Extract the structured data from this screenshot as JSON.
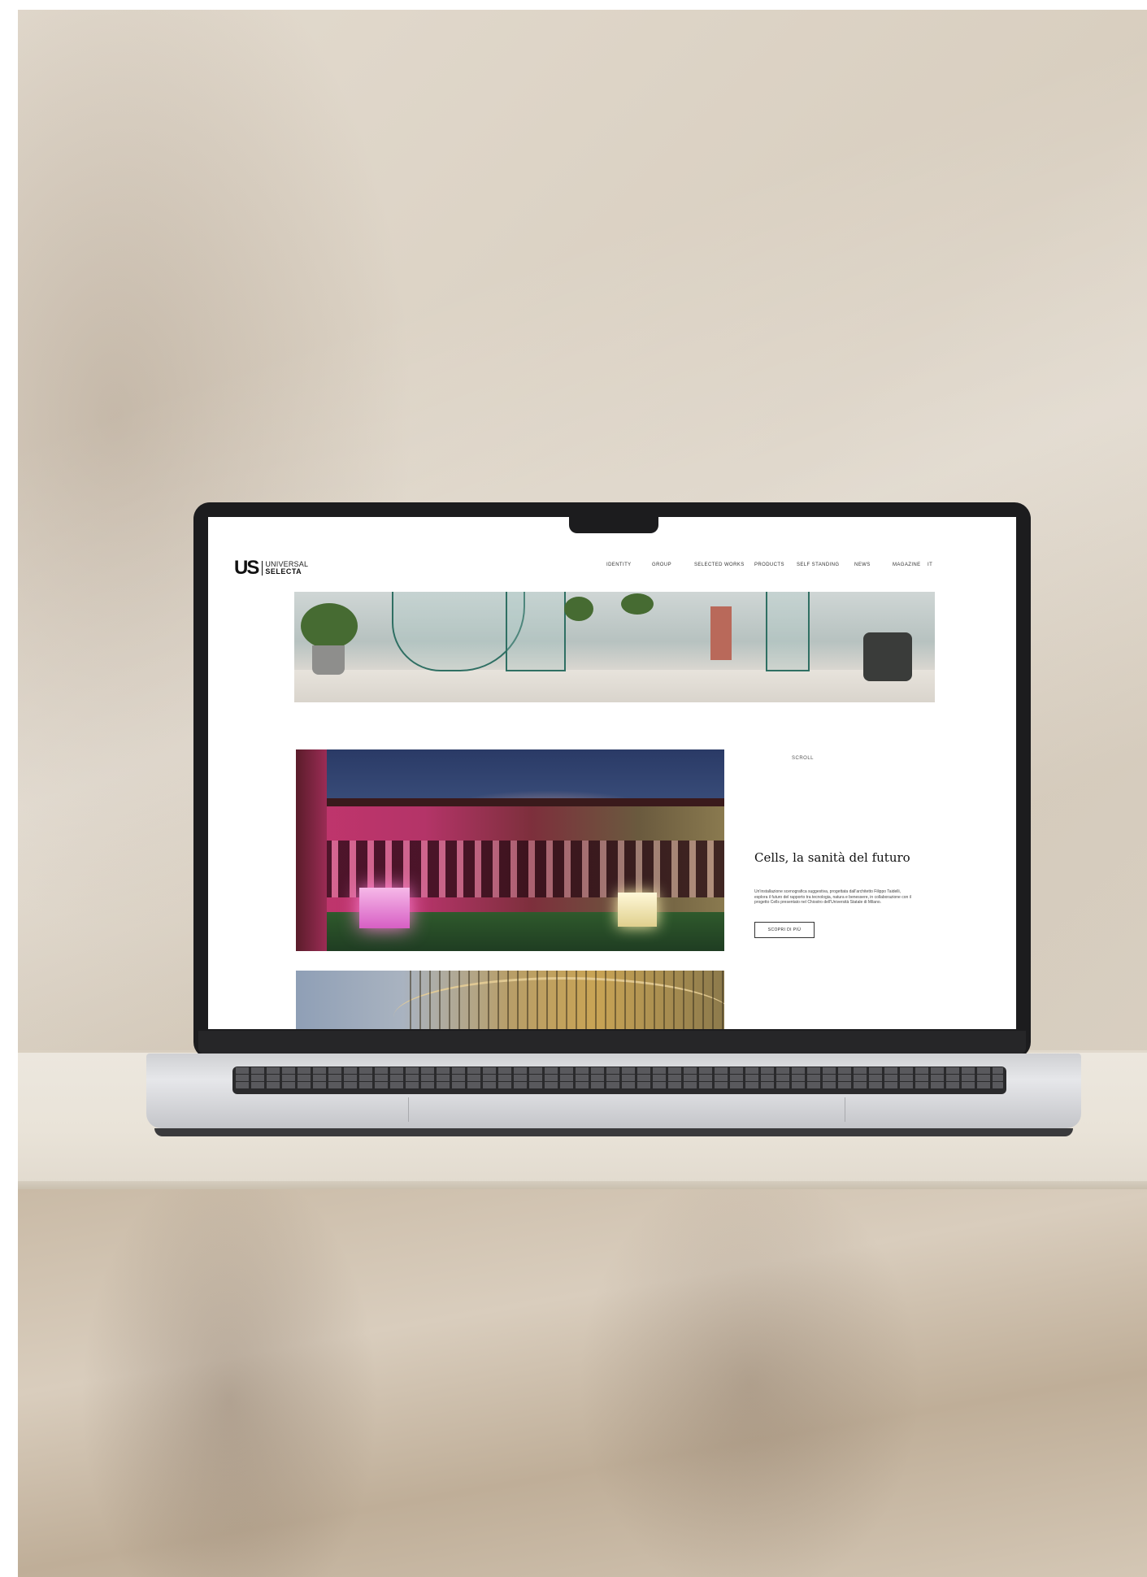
{
  "site": {
    "logo": {
      "mark": "US",
      "line1": "UNIVERSAL",
      "line2": "SELECTA"
    },
    "nav": [
      {
        "label": "IDENTITY"
      },
      {
        "label": "GROUP"
      },
      {
        "label": "SELECTED WORKS"
      },
      {
        "label": "PRODUCTS"
      },
      {
        "label": "SELF STANDING"
      },
      {
        "label": "NEWS"
      },
      {
        "label": "MAGAZINE"
      },
      {
        "label": "IT"
      }
    ],
    "scroll_label": "SCROLL",
    "feature": {
      "title": "Cells, la sanità del futuro",
      "description": "Un'installazione scenografica suggestiva, progettata dall'architetto Filippo Taidelli, esplora il futuro del rapporto tra tecnologia, natura e benessere, in collaborazione con il progetto Cells presentato nel Chiostro dell'Università Statale di Milano.",
      "cta_label": "SCOPRI DI PIÙ"
    }
  },
  "colors": {
    "wall": "#ddd4c7",
    "laptop_bezel": "#1c1c1e",
    "laptop_body": "#cfd0d3",
    "screen_bg": "#ffffff",
    "text_primary": "#111111"
  }
}
